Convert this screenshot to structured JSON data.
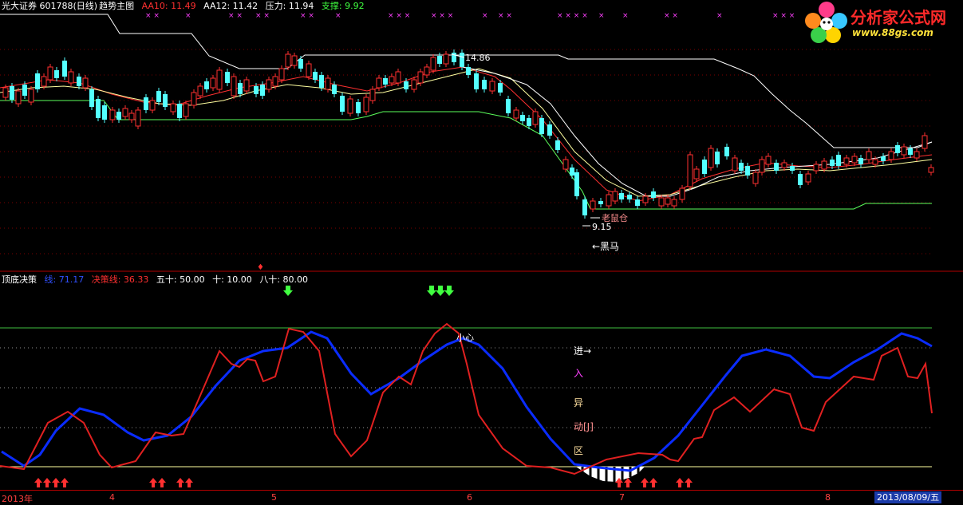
{
  "top_panel": {
    "stock": "光大证券 601788(日线)",
    "indicator": "趋势主图",
    "aa10": "AA10: 11.49",
    "aa12": "AA12: 11.42",
    "pressure": "压力: 11.94",
    "support": "支撑: 9.92",
    "high_label": "14.86",
    "low_label": "9.15",
    "note_cang": "老鼠仓",
    "note_horse": "←黑马"
  },
  "bottom_panel": {
    "title": "顶底决策",
    "line1": "线: 71.17",
    "line2": "决策线: 36.33",
    "fifty": "五十: 50.00",
    "ten": "十: 10.00",
    "eighty": "八十: 80.00",
    "careful": "小心",
    "side_words": [
      "进→",
      "入",
      "异",
      "动[J]",
      "区"
    ]
  },
  "x_axis": {
    "labels": [
      "2013年",
      "4",
      "5",
      "6",
      "7",
      "8"
    ],
    "current_date": "2013/08/09/五"
  },
  "logo": {
    "title": "分析家公式网",
    "url": "www.88gs.com"
  },
  "colors": {
    "up": "#ff3030",
    "down": "#54ffff",
    "blue_line": "#0a2cff",
    "red_line": "#e02020",
    "yellow": "#ffff40",
    "green": "#40ff40"
  }
}
